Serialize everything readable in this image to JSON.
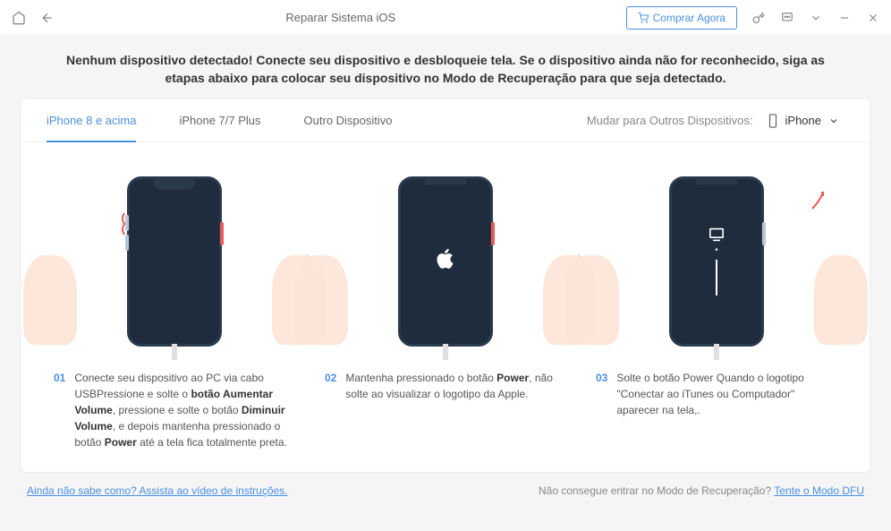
{
  "titlebar": {
    "title": "Reparar Sistema iOS",
    "buy_label": "Comprar Agora"
  },
  "notice": "Nenhum dispositivo detectado! Conecte seu dispositivo e desbloqueie tela. Se o dispositivo ainda não for reconhecido, siga as etapas abaixo para colocar seu dispositivo no Modo de Recuperação para que seja detectado.",
  "tabs": [
    {
      "label": "iPhone 8 e acima",
      "active": true
    },
    {
      "label": "iPhone 7/7 Plus",
      "active": false
    },
    {
      "label": "Outro Dispositivo",
      "active": false
    }
  ],
  "device_switch": {
    "label": "Mudar para Outros Dispositivos:",
    "selected": "iPhone"
  },
  "steps": [
    {
      "num": "01",
      "text_parts": [
        "Conecte seu dispositivo ao PC via cabo USBPressione e solte o ",
        "botão Aumentar Volume",
        ", pressione e solte o botão ",
        "Diminuir Volume",
        ", e depois mantenha pressionado o botão ",
        "Power",
        " até a tela fica totalmente preta."
      ]
    },
    {
      "num": "02",
      "text_parts": [
        "Mantenha pressionado o botão ",
        "Power",
        ", não solte ao visualizar o logotipo da Apple."
      ]
    },
    {
      "num": "03",
      "text_parts": [
        "Solte o botão Power Quando o logotipo \"Conectar ao iTunes ou Computador\" aparecer na tela,."
      ]
    }
  ],
  "footer": {
    "left_link": "Ainda não sabe como? Assista ao vídeo de instruções.",
    "right_text": "Não consegue entrar no Modo de Recuperação? ",
    "right_link": "Tente o Modo DFU"
  }
}
